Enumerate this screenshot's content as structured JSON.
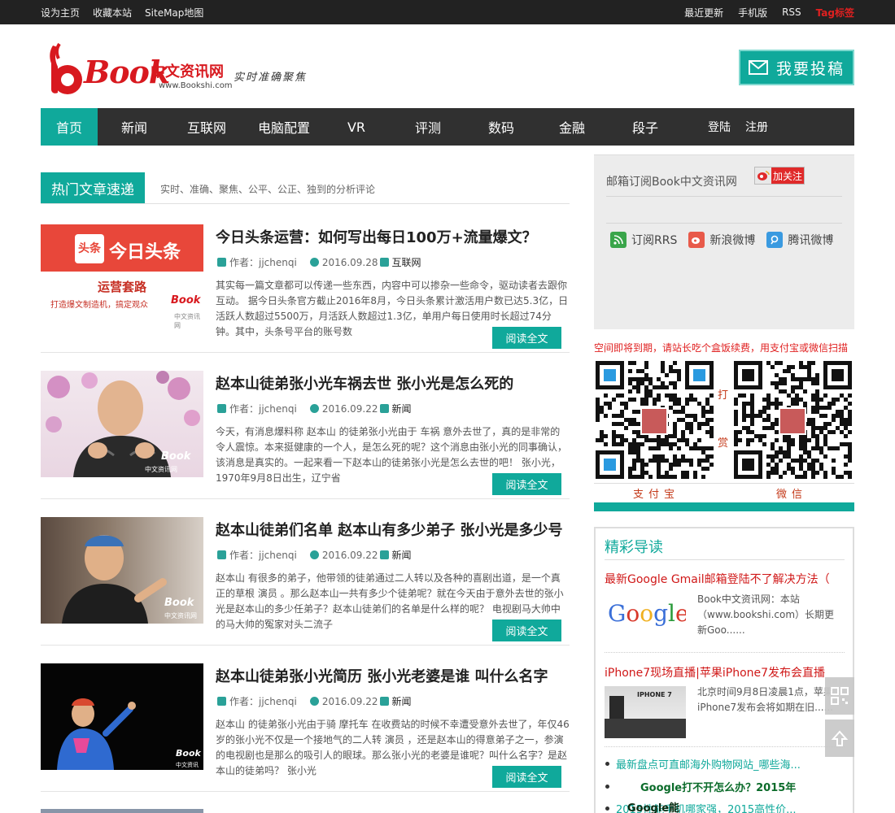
{
  "topbar": {
    "left_links": [
      "设为主页",
      "收藏本站",
      "SiteMap地图"
    ],
    "right_links": [
      "最近更新",
      "手机版",
      "RSS"
    ],
    "tag_link": "Tag标签"
  },
  "logo": {
    "brand": "Book",
    "cn_name": "中文资讯网",
    "url": "www.Bookshi.com",
    "slogan": "实时准确聚焦"
  },
  "submit_button": "我要投稿",
  "nav": {
    "items": [
      "首页",
      "新闻",
      "互联网",
      "电脑配置",
      "VR",
      "评测",
      "数码",
      "金融",
      "段子"
    ],
    "login": "登陆",
    "register": "注册"
  },
  "section": {
    "title": "热门文章速递",
    "desc": "实时、准确、聚焦、公平、公正、独到的分析评论"
  },
  "articles": [
    {
      "title": "今日头条运营：如何写出每日100万+流量爆文？",
      "author": "作者：jjchenqi",
      "date": "2016.09.28",
      "category": "互联网",
      "excerpt": "其实每一篇文章都可以传递一些东西，内容中可以掺杂一些命令，驱动读者去跟你互动。 据今日头条官方截止2016年8月，今日头条累计激活用户数已达5.3亿，日活跃人数超过5500万，月活跃人数超过1.3亿，单用户每日使用时长超过74分钟。其中，头条号平台的账号数",
      "read": "阅读全文",
      "thumb": {
        "line1": "头条",
        "line2": "今日头条",
        "line3": "运营套路",
        "line4": "打造爆文制造机，搞定观众",
        "mark": "Book",
        "sub": "中文资讯网"
      }
    },
    {
      "title": "赵本山徒弟张小光车祸去世 张小光是怎么死的",
      "author": "作者：jjchenqi",
      "date": "2016.09.22",
      "category": "新闻",
      "excerpt": "今天，有消息爆料称 赵本山 的徒弟张小光由于 车祸 意外去世了，真的是非常的令人震惊。本来挺健康的一个人，是怎么死的呢？这个消息由张小光的同事确认，该消息是真实的。一起来看一下赵本山的徒弟张小光是怎么去世的吧！ 张小光，1970年9月8日出生，辽宁省",
      "read": "阅读全文",
      "thumb": {
        "mark": "Book",
        "sub": "中文资讯网"
      }
    },
    {
      "title": "赵本山徒弟们名单 赵本山有多少弟子 张小光是多少号",
      "author": "作者：jjchenqi",
      "date": "2016.09.22",
      "category": "新闻",
      "excerpt": "赵本山 有很多的弟子，他带领的徒弟通过二人转以及各种的喜剧出道，是一个真正的草根 演员 。那么赵本山一共有多少个徒弟呢？就在今天由于意外去世的张小光是赵本山的多少任弟子？赵本山徒弟们的名单是什么样的呢？ 电视剧马大帅中的马大帅的冤家对头二流子",
      "read": "阅读全文",
      "thumb": {
        "mark": "Book",
        "sub": "中文资讯网"
      }
    },
    {
      "title": "赵本山徒弟张小光简历 张小光老婆是谁 叫什么名字",
      "author": "作者：jjchenqi",
      "date": "2016.09.22",
      "category": "新闻",
      "excerpt": "赵本山 的徒弟张小光由于骑 摩托车 在收费站的时候不幸遭受意外去世了，年仅46岁的张小光不仅是一个接地气的二人转 演员 ，还是赵本山的得意弟子之一，参演的电视剧也是那么的吸引人的眼球。那么张小光的老婆是谁呢？叫什么名字？是赵本山的徒弟吗？ 张小光",
      "read": "阅读全文",
      "thumb": {
        "mark": "Book",
        "sub": "中文资讯网"
      }
    }
  ],
  "subscribe": {
    "label": "邮箱订阅Book中文资讯网",
    "follow": "加关注",
    "links": [
      "订阅RRS",
      "新浪微博",
      "腾讯微博"
    ]
  },
  "donate": {
    "note": "空间即将到期，请站长吃个盒饭续费，用支付宝或微信扫描",
    "da": "打",
    "shang": "赏",
    "alipay": "支付宝",
    "wechat": "微信"
  },
  "featured": {
    "title": "精彩导读",
    "items": [
      {
        "title": "最新Google Gmail邮箱登陆不了解决方法（",
        "text": "Book中文资讯网：本站（www.bookshi.com）长期更新Goo......",
        "img": "Google"
      },
      {
        "title": "iPhone7现场直播|苹果iPhone7发布会直播",
        "text": "北京时间9月8日凌晨1点，苹果iPhone7发布会将如期在旧......",
        "img": "IPHONE 7"
      }
    ],
    "bullets": [
      "最新盘点可直邮海外购物网站_哪些海...",
      "Google打不开怎么办？2015年",
      "2015性能手机哪家强，2015高性价..."
    ],
    "overlap": "Google能"
  },
  "colors": {
    "accent": "#10a99b",
    "dark": "#303030",
    "red": "#d8191f"
  }
}
